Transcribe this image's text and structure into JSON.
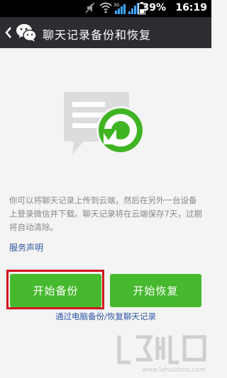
{
  "status_bar": {
    "battery_percent": "39%",
    "time": "16:19",
    "icons": [
      "mute-icon",
      "wifi-icon",
      "3g-signal-icon",
      "signal-icon",
      "battery-icon"
    ]
  },
  "header": {
    "title": "聊天记录备份和恢复",
    "back_icon": "chevron-left-icon",
    "logo_icon": "wechat-logo-icon"
  },
  "main": {
    "hero_icon": "chat-restore-icon",
    "description": "你可以将聊天记录上传到云端，然后在另外一台设备上登录微信并下载。聊天记录将在云端保存7天，过期将自动清除。",
    "terms_link": "服务声明",
    "backup_button": "开始备份",
    "restore_button": "开始恢复",
    "pc_backup_link": "通过电脑备份/恢复聊天记录"
  },
  "watermark": {
    "url": "www.lahuizhou.com"
  },
  "colors": {
    "status_bg": "#000000",
    "title_bg": "#2b2d31",
    "page_bg": "#f4f4f4",
    "button_green": "#46b92f",
    "link_blue": "#2e56a8",
    "highlight_red": "#d0161c"
  }
}
